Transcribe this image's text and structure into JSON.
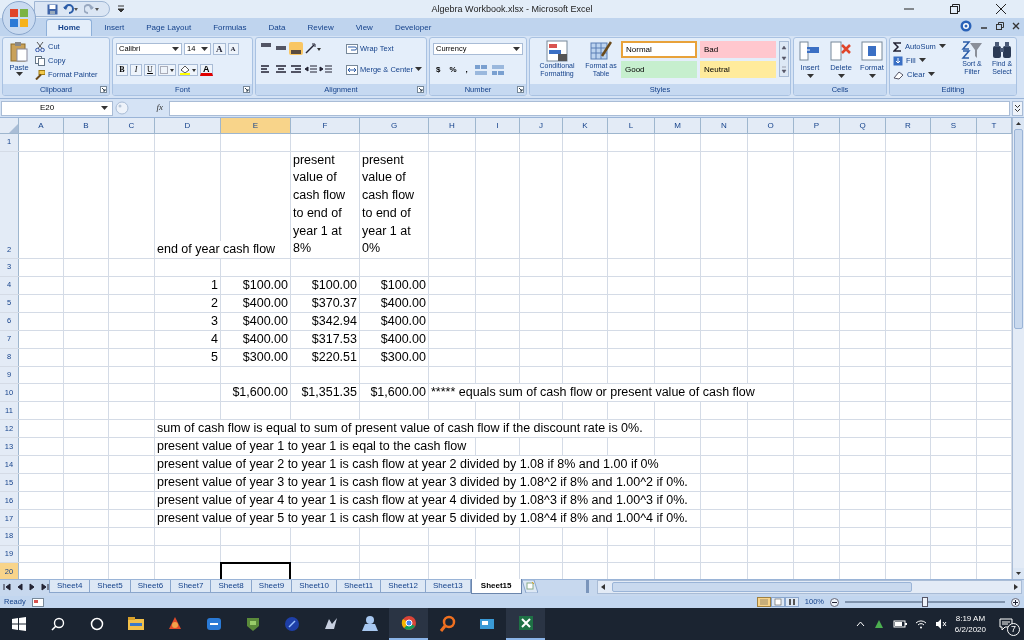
{
  "window": {
    "title": "Algebra Workbook.xlsx - Microsoft Excel"
  },
  "ribbon_tabs": [
    {
      "label": "Home",
      "selected": true
    },
    {
      "label": "Insert",
      "selected": false
    },
    {
      "label": "Page Layout",
      "selected": false
    },
    {
      "label": "Formulas",
      "selected": false
    },
    {
      "label": "Data",
      "selected": false
    },
    {
      "label": "Review",
      "selected": false
    },
    {
      "label": "View",
      "selected": false
    },
    {
      "label": "Developer",
      "selected": false
    }
  ],
  "clipboard": {
    "label": "Clipboard",
    "paste": "Paste",
    "cut": "Cut",
    "copy": "Copy",
    "format_painter": "Format Painter"
  },
  "font": {
    "label": "Font",
    "name": "Calibri",
    "size": "14",
    "grow": "A",
    "shrink": "A",
    "styles": [
      "B",
      "I",
      "U"
    ],
    "font_color": "A"
  },
  "alignment": {
    "label": "Alignment",
    "wrap_text": "Wrap Text",
    "merge": "Merge & Center"
  },
  "number": {
    "label": "Number",
    "format": "Currency",
    "symbols": [
      "$",
      "%",
      ","
    ]
  },
  "styles": {
    "label": "Styles",
    "conditional": "Conditional Formatting",
    "format_table": "Format as Table",
    "cell_styles": [
      {
        "label": "Normal",
        "color": "#ffffff",
        "selected": true
      },
      {
        "label": "Bad",
        "color": "#ffc7ce",
        "selected": false
      },
      {
        "label": "Good",
        "color": "#c6efce",
        "selected": false
      },
      {
        "label": "Neutral",
        "color": "#ffeb9c",
        "selected": false
      }
    ]
  },
  "cells": {
    "label": "Cells",
    "buttons": [
      "Insert",
      "Delete",
      "Format"
    ]
  },
  "editing": {
    "label": "Editing",
    "autosum": "AutoSum",
    "fill": "Fill",
    "clear": "Clear",
    "sort": "Sort & Filter",
    "find": "Find & Select"
  },
  "formula_bar": {
    "name_box": "E20",
    "function_label": "fx"
  },
  "columns": [
    {
      "label": "A",
      "selected": false
    },
    {
      "label": "B",
      "selected": false
    },
    {
      "label": "C",
      "selected": false
    },
    {
      "label": "D",
      "selected": false
    },
    {
      "label": "E",
      "selected": true
    },
    {
      "label": "F",
      "selected": false
    },
    {
      "label": "G",
      "selected": false
    },
    {
      "label": "H",
      "selected": false
    },
    {
      "label": "I",
      "selected": false
    },
    {
      "label": "J",
      "selected": false
    },
    {
      "label": "K",
      "selected": false
    },
    {
      "label": "L",
      "selected": false
    },
    {
      "label": "M",
      "selected": false
    },
    {
      "label": "N",
      "selected": false
    },
    {
      "label": "O",
      "selected": false
    },
    {
      "label": "P",
      "selected": false
    },
    {
      "label": "Q",
      "selected": false
    },
    {
      "label": "R",
      "selected": false
    },
    {
      "label": "S",
      "selected": false
    },
    {
      "label": "T",
      "selected": false
    }
  ],
  "rows": [
    {
      "label": "1",
      "selected": false
    },
    {
      "label": "2",
      "selected": false,
      "cells": {
        "D": {
          "kind": "text",
          "text": "end of year"
        },
        "E": {
          "kind": "text",
          "text": "cash flow"
        },
        "F": {
          "kind": "wrap",
          "text": "present value of cash flow to end of year 1 at 8%"
        },
        "G": {
          "kind": "wrap",
          "text": "present value of cash flow to end of year 1 at 0%"
        }
      }
    },
    {
      "label": "3",
      "selected": false
    },
    {
      "label": "4",
      "selected": false,
      "cells": {
        "D": {
          "kind": "number",
          "text": "1"
        },
        "E": {
          "kind": "number",
          "text": "$100.00"
        },
        "F": {
          "kind": "number",
          "text": "$100.00"
        },
        "G": {
          "kind": "number",
          "text": "$100.00"
        }
      }
    },
    {
      "label": "5",
      "selected": false,
      "cells": {
        "D": {
          "kind": "number",
          "text": "2"
        },
        "E": {
          "kind": "number",
          "text": "$400.00"
        },
        "F": {
          "kind": "number",
          "text": "$370.37"
        },
        "G": {
          "kind": "number",
          "text": "$400.00"
        }
      }
    },
    {
      "label": "6",
      "selected": false,
      "cells": {
        "D": {
          "kind": "number",
          "text": "3"
        },
        "E": {
          "kind": "number",
          "text": "$400.00"
        },
        "F": {
          "kind": "number",
          "text": "$342.94"
        },
        "G": {
          "kind": "number",
          "text": "$400.00"
        }
      }
    },
    {
      "label": "7",
      "selected": false,
      "cells": {
        "D": {
          "kind": "number",
          "text": "4"
        },
        "E": {
          "kind": "number",
          "text": "$400.00"
        },
        "F": {
          "kind": "number",
          "text": "$317.53"
        },
        "G": {
          "kind": "number",
          "text": "$400.00"
        }
      }
    },
    {
      "label": "8",
      "selected": false,
      "cells": {
        "D": {
          "kind": "number",
          "text": "5"
        },
        "E": {
          "kind": "number",
          "text": "$300.00"
        },
        "F": {
          "kind": "number",
          "text": "$220.51"
        },
        "G": {
          "kind": "number",
          "text": "$300.00"
        }
      }
    },
    {
      "label": "9",
      "selected": false
    },
    {
      "label": "10",
      "selected": false,
      "cells": {
        "E": {
          "kind": "number",
          "text": "$1,600.00"
        },
        "F": {
          "kind": "number",
          "text": "$1,351.35"
        },
        "G": {
          "kind": "number",
          "text": "$1,600.00"
        },
        "H": {
          "kind": "text",
          "text": "***** equals sum of cash flow or present value of cash flow"
        }
      }
    },
    {
      "label": "11",
      "selected": false
    },
    {
      "label": "12",
      "selected": false,
      "cells": {
        "D": {
          "kind": "text",
          "text": "sum of cash flow is equal to sum of present value of cash flow if the discount rate is 0%."
        }
      }
    },
    {
      "label": "13",
      "selected": false,
      "cells": {
        "D": {
          "kind": "text",
          "text": "present value of year 1 to year 1 is eqal to the cash flow"
        }
      }
    },
    {
      "label": "14",
      "selected": false,
      "cells": {
        "D": {
          "kind": "text",
          "text": "present value of year 2 to year 1 is cash flow at year 2 divided by 1.08 if 8% and 1.00 if 0%"
        }
      }
    },
    {
      "label": "15",
      "selected": false,
      "cells": {
        "D": {
          "kind": "text",
          "text": "present value of year 3 to year 1 is cash flow at year 3 divided by 1.08^2 if 8% and 1.00^2 if 0%."
        }
      }
    },
    {
      "label": "16",
      "selected": false,
      "cells": {
        "D": {
          "kind": "text",
          "text": "present value of year 4 to year 1 is  cash flow at year 4 divided by 1.08^3 if 8% and 1.00^3 if 0%."
        }
      }
    },
    {
      "label": "17",
      "selected": false,
      "cells": {
        "D": {
          "kind": "text",
          "text": "present value of year 5 to year 1 is cash flow at year 5 divided by 1.08^4 if 8% and 1.00^4 if 0%."
        }
      }
    },
    {
      "label": "18",
      "selected": false
    },
    {
      "label": "19",
      "selected": false
    },
    {
      "label": "20",
      "selected": true
    }
  ],
  "sheet_tabs": [
    {
      "label": "Sheet4",
      "selected": false
    },
    {
      "label": "Sheet5",
      "selected": false
    },
    {
      "label": "Sheet6",
      "selected": false
    },
    {
      "label": "Sheet7",
      "selected": false
    },
    {
      "label": "Sheet8",
      "selected": false
    },
    {
      "label": "Sheet9",
      "selected": false
    },
    {
      "label": "Sheet10",
      "selected": false
    },
    {
      "label": "Sheet11",
      "selected": false
    },
    {
      "label": "Sheet12",
      "selected": false
    },
    {
      "label": "Sheet13",
      "selected": false
    },
    {
      "label": "Sheet15",
      "selected": true
    }
  ],
  "status_bar": {
    "status": "Ready",
    "zoom": "100%",
    "zoom_slider": {
      "level": 0.5
    }
  },
  "taskbar": {
    "time": "8:19 AM",
    "date": "6/2/2020",
    "notifications": "7"
  }
}
